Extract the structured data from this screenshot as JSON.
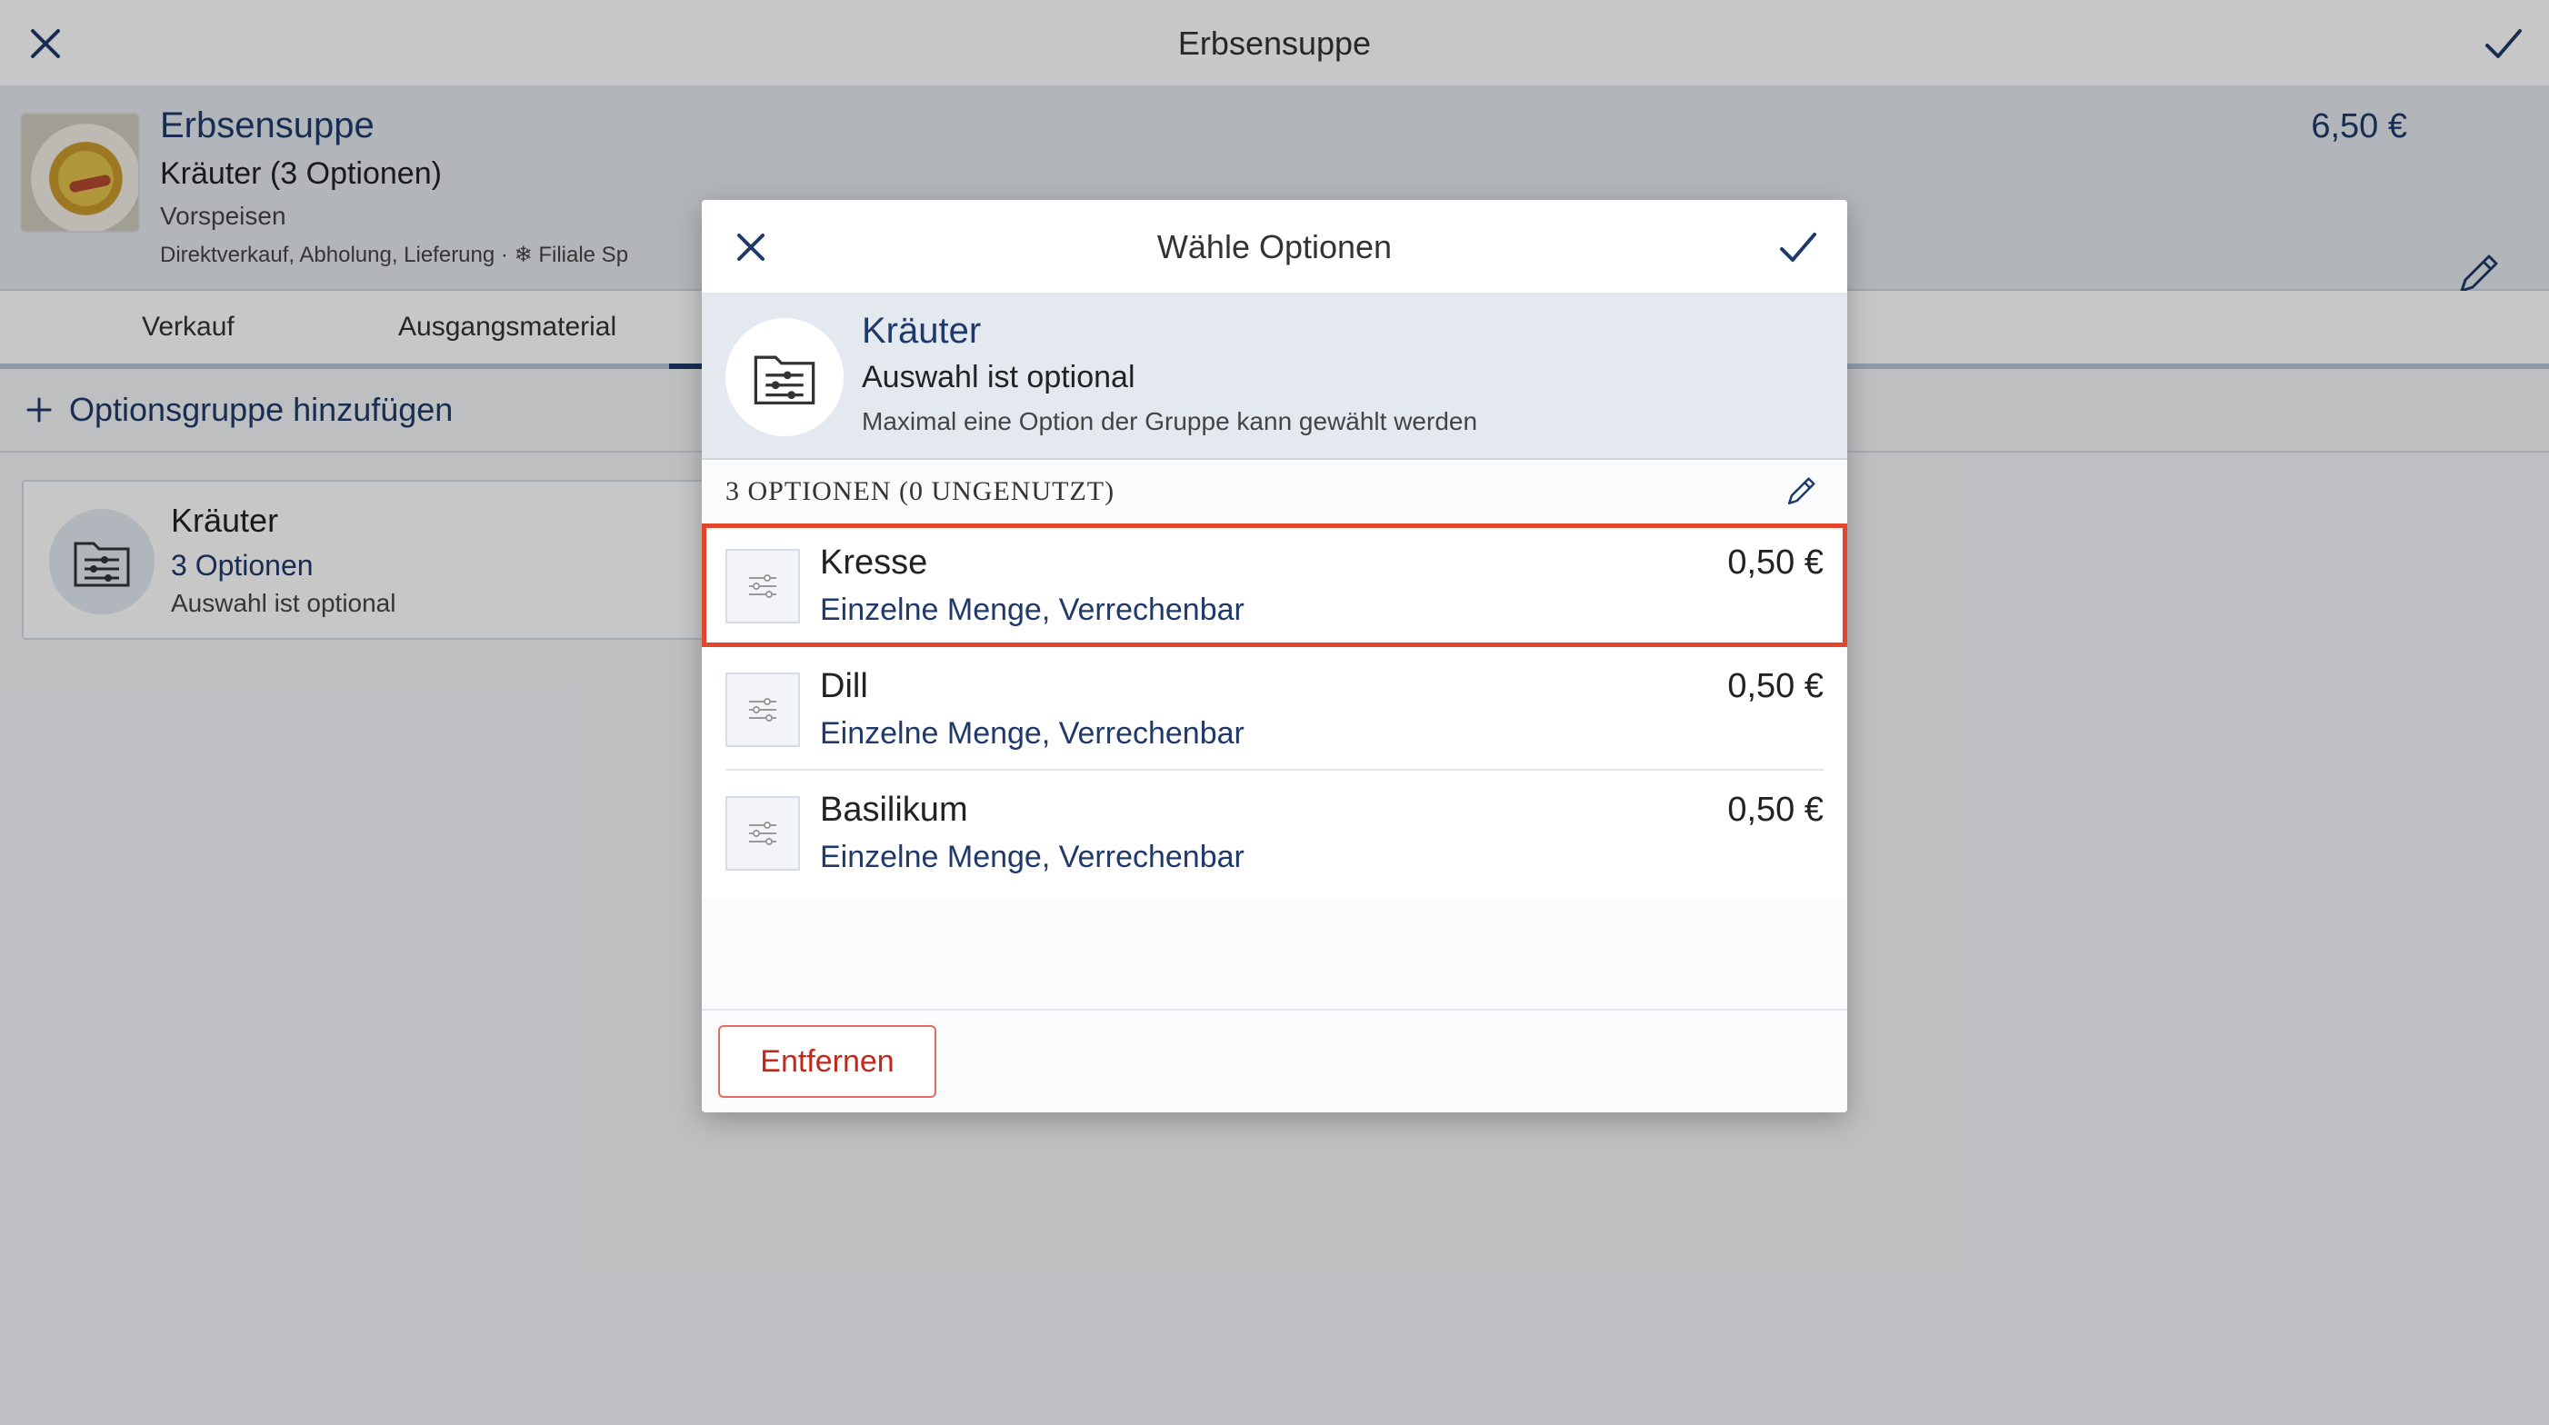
{
  "topbar": {
    "title": "Erbsensuppe"
  },
  "item": {
    "name": "Erbsensuppe",
    "subtitle": "Kräuter (3 Optionen)",
    "category": "Vorspeisen",
    "channels": "Direktverkauf, Abholung, Lieferung · ❄ Filiale Sp",
    "price": "6,50 €"
  },
  "tabs": [
    {
      "label": "Verkauf"
    },
    {
      "label": "Ausgangsmaterial"
    }
  ],
  "add_group_label": "Optionsgruppe hinzufügen",
  "group_card": {
    "name": "Kräuter",
    "count": "3 Optionen",
    "optional": "Auswahl ist optional"
  },
  "dialog": {
    "title": "Wähle Optionen",
    "group": {
      "name": "Kräuter",
      "optional": "Auswahl ist optional",
      "max": "Maximal eine Option der Gruppe kann gewählt werden"
    },
    "section_label": "3 OPTIONEN (0 UNGENUTZT)",
    "options": [
      {
        "name": "Kresse",
        "desc": "Einzelne Menge, Verrechenbar",
        "price": "0,50 €"
      },
      {
        "name": "Dill",
        "desc": "Einzelne Menge, Verrechenbar",
        "price": "0,50 €"
      },
      {
        "name": "Basilikum",
        "desc": "Einzelne Menge, Verrechenbar",
        "price": "0,50 €"
      }
    ],
    "remove_label": "Entfernen"
  },
  "colors": {
    "accent": "#1f3a6a",
    "selection": "#e2462c",
    "danger": "#c0281c"
  },
  "icons": [
    "close-icon",
    "check-icon",
    "pencil-icon",
    "plus-icon",
    "options-folder-icon",
    "sliders-icon"
  ]
}
